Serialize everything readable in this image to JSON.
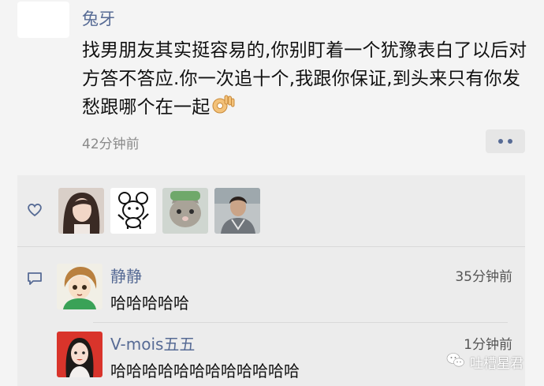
{
  "post": {
    "username": "兔牙",
    "text": "找男朋友其实挺容易的,你别盯着一个犹豫表白了以后对方答不答应.你一次追十个,我跟你保证,到头来只有你发愁跟哪个在一起",
    "time": "42分钟前"
  },
  "likes": {
    "avatars": [
      "girl-avatar",
      "cartoon-mouse-avatar",
      "cat-avatar",
      "boy-avatar"
    ]
  },
  "comments": [
    {
      "name": "静静",
      "time": "35分钟前",
      "text": "哈哈哈哈哈"
    },
    {
      "name": "V-mois五五",
      "time": "1分钟前",
      "text": "哈哈哈哈哈哈哈哈哈哈哈哈"
    }
  ],
  "watermark": {
    "text": "吐槽星君"
  },
  "colors": {
    "link": "#576b95",
    "background": "#f4f4f4",
    "panel": "#ececec"
  }
}
